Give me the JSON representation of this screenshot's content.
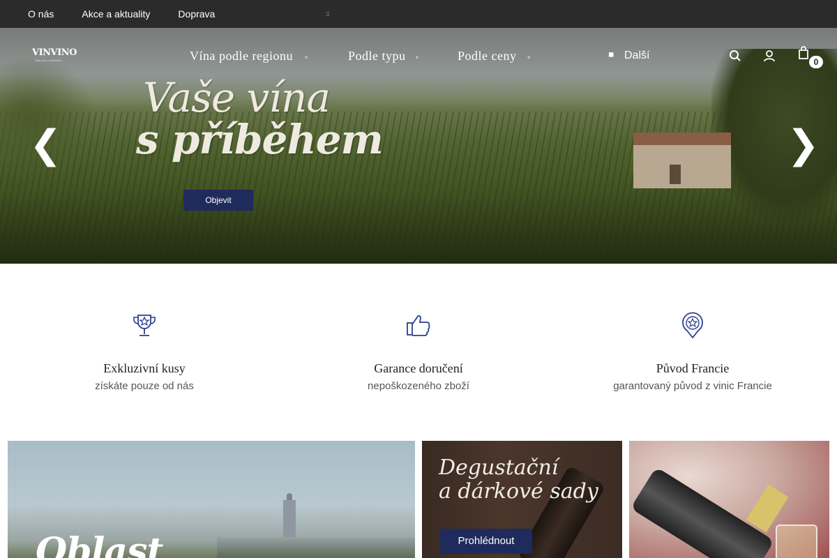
{
  "topbar": {
    "links": [
      "O nás",
      "Akce a aktuality",
      "Doprava"
    ],
    "tiny_glyph": "▯"
  },
  "header": {
    "logo_text": "VINVINO",
    "logo_sub": "Vaše vína s příběhem",
    "nav": [
      "Vína podle regionu",
      "Podle typu",
      "Podle ceny"
    ],
    "more_label": "Další",
    "cart_count": "0"
  },
  "hero": {
    "title_line1": "Vaše vína",
    "title_line2": "s příběhem",
    "button_label": "Objevit",
    "prev_glyph": "❮",
    "next_glyph": "❯"
  },
  "features": [
    {
      "icon": "trophy-icon",
      "title": "Exkluzivní kusy",
      "subtitle": "získáte pouze od nás"
    },
    {
      "icon": "thumbs-up-icon",
      "title": "Garance doručení",
      "subtitle": "nepoškozeného zboží"
    },
    {
      "icon": "badge-pin-icon",
      "title": "Původ Francie",
      "subtitle": "garantovaný původ z vinic Francie"
    }
  ],
  "banners": {
    "region_title": "Oblast",
    "sets_title_line1": "Degustační",
    "sets_title_line2": "a dárkové sady",
    "sets_button": "Prohlédnout"
  },
  "colors": {
    "accent_navy": "#1f2b5c",
    "topbar_bg": "#2b2b2b",
    "icon_blue": "#2c3e8c"
  }
}
